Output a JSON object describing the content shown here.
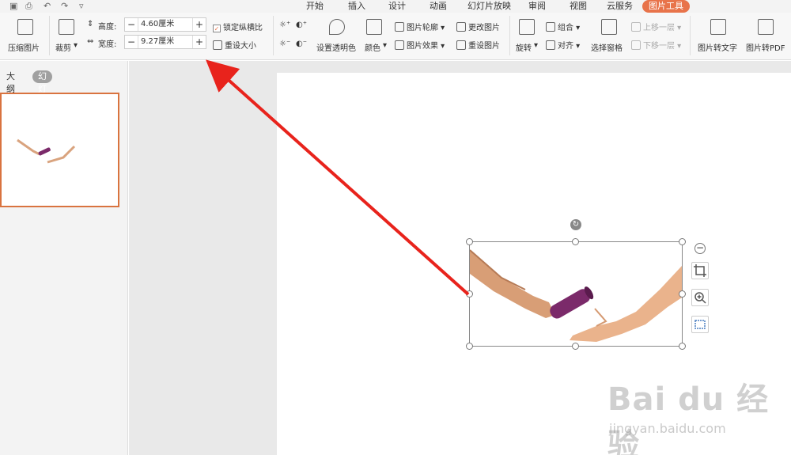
{
  "menu_tabs": [
    "开始",
    "插入",
    "设计",
    "动画",
    "幻灯片放映",
    "审阅",
    "视图",
    "云服务",
    "图片工具"
  ],
  "ribbon": {
    "compress": "压缩图片",
    "crop": "裁剪",
    "height_label": "高度:",
    "height_value": "4.60厘米",
    "width_label": "宽度:",
    "width_value": "9.27厘米",
    "lock_ratio": "锁定纵横比",
    "reset_size": "重设大小",
    "transparent": "设置透明色",
    "color": "颜色",
    "outline": "图片轮廓",
    "effects": "图片效果",
    "change_pic": "更改图片",
    "reset_pic": "重设图片",
    "rotate": "旋转",
    "group": "组合",
    "align": "对齐",
    "selection_pane": "选择窗格",
    "bring_forward": "上移一层",
    "send_backward": "下移一层",
    "pic_to_text": "图片转文字",
    "pic_to_pdf": "图片转PDF"
  },
  "panel_tabs": [
    "大纲",
    "幻灯片"
  ],
  "watermark": {
    "text": "Bai du 经验",
    "url": "jingyan.baidu.com"
  },
  "colors": {
    "accent": "#e8734a",
    "arrow": "#e8231c"
  }
}
